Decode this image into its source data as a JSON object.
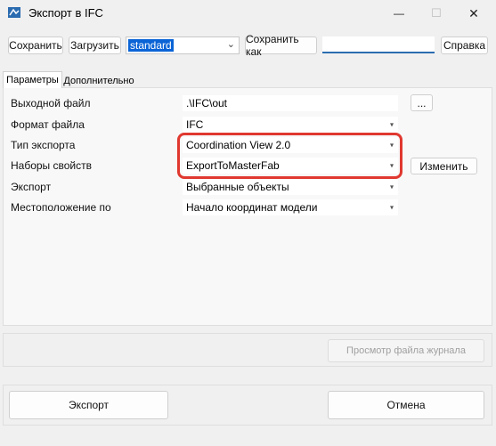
{
  "window": {
    "title": "Экспорт в IFC",
    "controls": {
      "minimize": "—",
      "maximize": "☐",
      "close": "✕"
    }
  },
  "toolbar": {
    "save": "Сохранить",
    "load": "Загрузить",
    "config_value": "standard",
    "save_as": "Сохранить как",
    "save_as_name": "",
    "help": "Справка"
  },
  "tabs": {
    "params": "Параметры",
    "extra": "Дополнительно"
  },
  "params": {
    "rows": [
      {
        "label": "Выходной файл",
        "value": ".\\IFC\\out",
        "kind": "text"
      },
      {
        "label": "Формат файла",
        "value": "IFC",
        "kind": "combo"
      },
      {
        "label": "Тип экспорта",
        "value": "Coordination View 2.0",
        "kind": "combo"
      },
      {
        "label": "Наборы свойств",
        "value": "ExportToMasterFab",
        "kind": "combo"
      },
      {
        "label": "Экспорт",
        "value": "Выбранные объекты",
        "kind": "combo"
      },
      {
        "label": "Местоположение по",
        "value": "Начало координат модели",
        "kind": "combo"
      }
    ],
    "browse_button": "...",
    "change_button": "Изменить"
  },
  "log_button": "Просмотр файла журнала",
  "footer": {
    "export": "Экспорт",
    "cancel": "Отмена"
  },
  "colors": {
    "highlight": "#e0382f",
    "selection": "#0a64d6",
    "accent": "#2b6cb0"
  }
}
